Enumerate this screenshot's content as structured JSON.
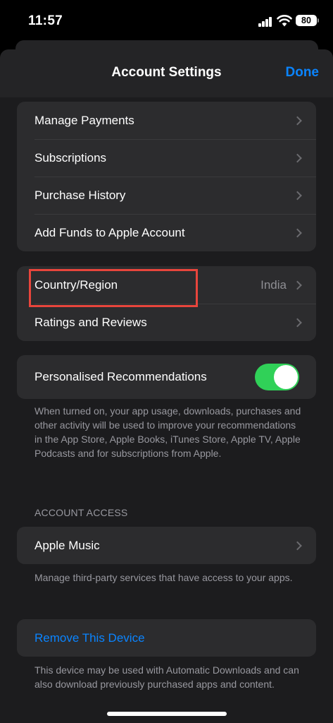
{
  "status_bar": {
    "time": "11:57",
    "battery": "80"
  },
  "nav": {
    "title": "Account Settings",
    "done": "Done"
  },
  "payments_group": [
    {
      "label": "Manage Payments"
    },
    {
      "label": "Subscriptions"
    },
    {
      "label": "Purchase History"
    },
    {
      "label": "Add Funds to Apple Account"
    }
  ],
  "region_group": [
    {
      "label": "Country/Region",
      "value": "India"
    },
    {
      "label": "Ratings and Reviews"
    }
  ],
  "personalised": {
    "label": "Personalised Recommendations",
    "enabled": true,
    "footnote": "When turned on, your app usage, downloads, purchases and other activity will be used to improve your recommendations in the App Store, Apple Books, iTunes Store, Apple TV, Apple Podcasts and for subscriptions from Apple."
  },
  "account_access": {
    "header": "ACCOUNT ACCESS",
    "item": "Apple Music",
    "footnote": "Manage third-party services that have access to your apps."
  },
  "remove_device": {
    "label": "Remove This Device",
    "footnote": "This device may be used with Automatic Downloads and can also download previously purchased apps and content."
  },
  "colors": {
    "accent": "#0a84ff",
    "toggle_on": "#30d158",
    "highlight": "#e8453c",
    "cell_bg": "#2c2c2e"
  },
  "icons": [
    "chevron-right-icon",
    "signal-icon",
    "wifi-icon",
    "battery-icon"
  ]
}
